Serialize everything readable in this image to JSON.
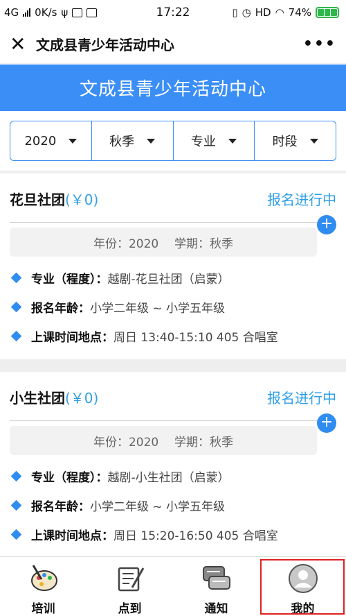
{
  "status_bar": {
    "network": "4G",
    "speed": "0K/s",
    "time": "17:22",
    "hd": "HD",
    "battery": "74%"
  },
  "nav": {
    "title": "文成县青少年活动中心"
  },
  "banner": {
    "title": "文成县青少年活动中心"
  },
  "filters": [
    "2020",
    "秋季",
    "专业",
    "时段"
  ],
  "courses": [
    {
      "name": "花旦社团",
      "price": "(￥0)",
      "status": "报名进行中",
      "year_label": "年份：2020",
      "term_label": "学期：秋季",
      "major_label": "专业（程度）：",
      "major_value": "越剧-花旦社团（启蒙）",
      "age_label": "报名年龄：",
      "age_value": "小学二年级 ~ 小学五年级",
      "time_label": "上课时间地点：",
      "time_value": "周日 13:40-15:10 405 合唱室"
    },
    {
      "name": "小生社团",
      "price": "(￥0)",
      "status": "报名进行中",
      "year_label": "年份：2020",
      "term_label": "学期：秋季",
      "major_label": "专业（程度）：",
      "major_value": "越剧-小生社团（启蒙）",
      "age_label": "报名年龄：",
      "age_value": "小学二年级 ~ 小学五年级",
      "time_label": "上课时间地点：",
      "time_value": "周日 15:20-16:50 405 合唱室"
    }
  ],
  "tabs": [
    {
      "label": "培训",
      "icon": "palette-icon"
    },
    {
      "label": "点到",
      "icon": "checkin-icon"
    },
    {
      "label": "通知",
      "icon": "chat-icon"
    },
    {
      "label": "我的",
      "icon": "user-icon"
    }
  ],
  "colors": {
    "primary": "#3a8ef6",
    "link": "#2f9fe8",
    "highlight": "#e02020",
    "battery": "#2cb84a"
  }
}
